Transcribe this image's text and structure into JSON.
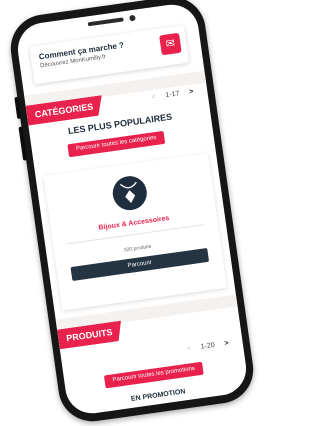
{
  "header": {
    "title": "Comment ça marche ?",
    "subtitle": "Découvrez MonKumilly.fr",
    "chat_icon": "chat-bubble-icon"
  },
  "categories": {
    "label": "CATÉGORIES",
    "pager": {
      "prev": "<",
      "range": "1-17",
      "next": ">"
    },
    "heading": "LES PLUS POPULAIRES",
    "browse_all": "Parcourir toutes les catégories",
    "item": {
      "icon": "necklace-icon",
      "name": "Bijoux & Accessoires",
      "count": "320 produits",
      "button": "Parcourir"
    }
  },
  "products": {
    "label": "PRODUITS",
    "pager": {
      "prev": "<",
      "range": "1-20",
      "next": ">"
    },
    "browse_promos": "Parcourir toutes les promotions",
    "promo_heading": "EN PROMOTION"
  },
  "colors": {
    "accent": "#e8224d",
    "dark": "#1f2e3e",
    "phone": "#161616"
  }
}
